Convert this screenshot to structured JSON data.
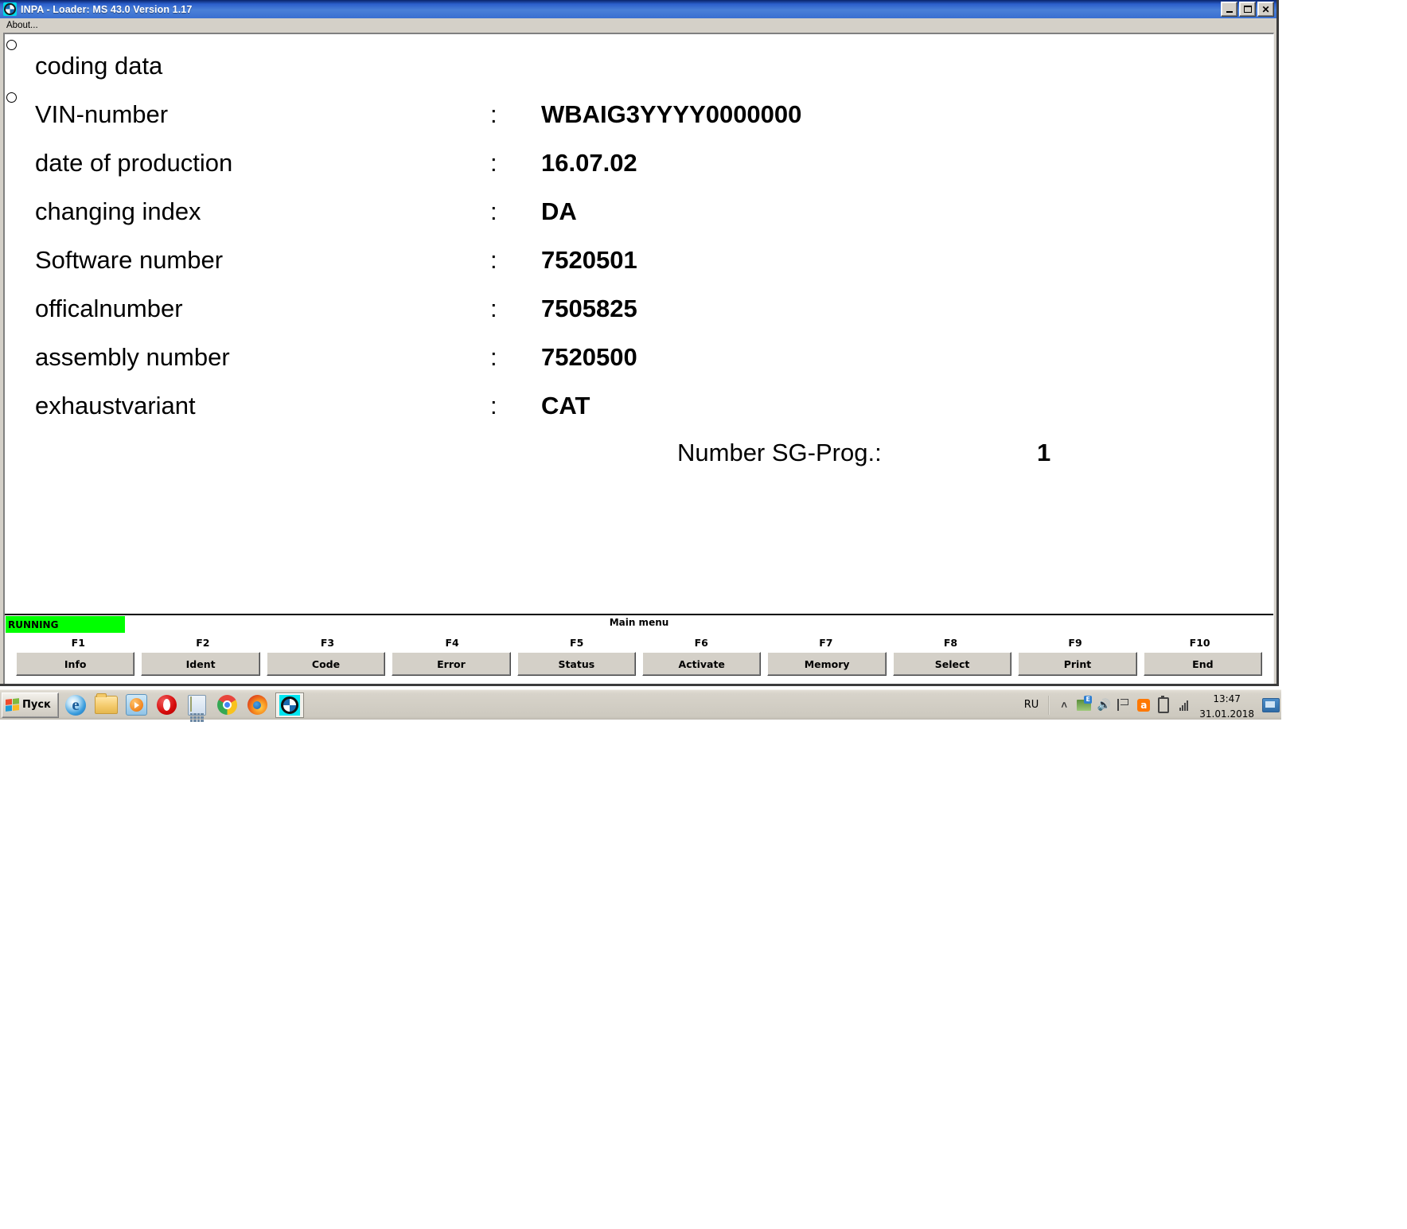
{
  "window": {
    "title": "INPA - Loader:  MS 43.0 Version 1.17",
    "icon": "bmw-logo-icon",
    "controls": {
      "minimize": "_",
      "maximize": "□",
      "close": "✕"
    },
    "menu": [
      {
        "label": "About..."
      }
    ]
  },
  "content": {
    "heading": "coding data",
    "colon": ":",
    "rows": [
      {
        "label": "VIN-number",
        "value": "WBAIG3YYYY0000000"
      },
      {
        "label": "date of production",
        "value": "16.07.02"
      },
      {
        "label": "changing index",
        "value": "DA"
      },
      {
        "label": "Software number",
        "value": "7520501"
      },
      {
        "label": "officalnumber",
        "value": "7505825"
      },
      {
        "label": "assembly number",
        "value": "7520500"
      },
      {
        "label": "exhaustvariant",
        "value": "CAT"
      }
    ],
    "sg_prog": {
      "label": "Number SG-Prog.:",
      "value": "1"
    }
  },
  "status": {
    "running_label": "RUNNING",
    "running_color": "#00FF00",
    "menu_title": "Main menu"
  },
  "fkeys": [
    {
      "key": "F1",
      "label": "Info"
    },
    {
      "key": "F2",
      "label": "Ident"
    },
    {
      "key": "F3",
      "label": "Code"
    },
    {
      "key": "F4",
      "label": "Error"
    },
    {
      "key": "F5",
      "label": "Status"
    },
    {
      "key": "F6",
      "label": "Activate"
    },
    {
      "key": "F7",
      "label": "Memory"
    },
    {
      "key": "F8",
      "label": "Select"
    },
    {
      "key": "F9",
      "label": "Print"
    },
    {
      "key": "F10",
      "label": "End"
    }
  ],
  "taskbar": {
    "start_label": "Пуск",
    "apps": [
      {
        "name": "internet-explorer-icon",
        "label": "e"
      },
      {
        "name": "windows-explorer-icon",
        "label": ""
      },
      {
        "name": "windows-media-player-icon",
        "label": ""
      },
      {
        "name": "opera-icon",
        "label": ""
      },
      {
        "name": "calculator-icon",
        "label": ""
      },
      {
        "name": "google-chrome-icon",
        "label": ""
      },
      {
        "name": "firefox-icon",
        "label": ""
      },
      {
        "name": "inpa-bmw-window-icon",
        "label": ""
      }
    ],
    "language": "RU",
    "tray": [
      {
        "name": "show-hidden-icons-chevron-icon"
      },
      {
        "name": "network-connection-icon"
      },
      {
        "name": "volume-speaker-icon"
      },
      {
        "name": "action-center-flag-icon"
      },
      {
        "name": "avast-antivirus-icon",
        "label": "a"
      },
      {
        "name": "battery-icon"
      },
      {
        "name": "signal-strength-icon"
      }
    ],
    "clock": {
      "time": "13:47",
      "date": "31.01.2018"
    }
  }
}
